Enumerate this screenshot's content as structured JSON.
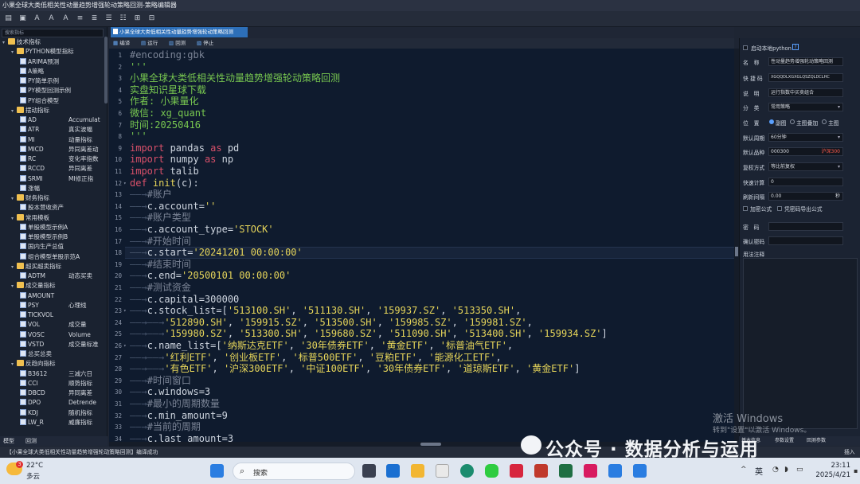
{
  "window": {
    "title": "小果全球大类低相关性动量趋势增强轮动策略回测-策略编辑器"
  },
  "toolbar": {
    "icons": [
      "save-icon",
      "save-as-icon",
      "font-increase-icon",
      "font-decrease-icon",
      "font-bold-icon",
      "indent-icon",
      "outdent-icon",
      "comment-icon",
      "list-icon",
      "format-icon",
      "export-icon"
    ]
  },
  "sidebar": {
    "search_placeholder": "搜索指标",
    "tree": [
      {
        "level": 0,
        "type": "folder",
        "open": true,
        "label": "技术指标"
      },
      {
        "level": 1,
        "type": "folder",
        "open": true,
        "label": "PYTHON模型指标"
      },
      {
        "level": 2,
        "type": "item",
        "label": "ARIMA预测",
        "desc": ""
      },
      {
        "level": 2,
        "type": "item",
        "label": "A策略",
        "desc": ""
      },
      {
        "level": 2,
        "type": "item",
        "label": "PY简单示例",
        "desc": ""
      },
      {
        "level": 2,
        "type": "item",
        "label": "PY模型回测示例",
        "desc": ""
      },
      {
        "level": 2,
        "type": "item",
        "label": "PY组合模型",
        "desc": ""
      },
      {
        "level": 1,
        "type": "folder",
        "open": true,
        "label": "摆动指标"
      },
      {
        "level": 2,
        "type": "item",
        "label": "AD",
        "desc": "Accumulat"
      },
      {
        "level": 2,
        "type": "item",
        "label": "ATR",
        "desc": "真实波幅"
      },
      {
        "level": 2,
        "type": "item",
        "label": "MI",
        "desc": "动量指标"
      },
      {
        "level": 2,
        "type": "item",
        "label": "MICD",
        "desc": "异同离差动"
      },
      {
        "level": 2,
        "type": "item",
        "label": "RC",
        "desc": "变化率指数"
      },
      {
        "level": 2,
        "type": "item",
        "label": "RCCD",
        "desc": "异同离差"
      },
      {
        "level": 2,
        "type": "item",
        "label": "SRMI",
        "desc": "MI修正指"
      },
      {
        "level": 2,
        "type": "item",
        "label": "涨幅",
        "desc": ""
      },
      {
        "level": 1,
        "type": "folder",
        "open": true,
        "label": "财务指标"
      },
      {
        "level": 2,
        "type": "item",
        "label": "股本营收资产",
        "desc": ""
      },
      {
        "level": 1,
        "type": "folder",
        "open": true,
        "label": "常用模板"
      },
      {
        "level": 2,
        "type": "item",
        "label": "单股模型示例A",
        "desc": ""
      },
      {
        "level": 2,
        "type": "item",
        "label": "单股模型示例B",
        "desc": ""
      },
      {
        "level": 2,
        "type": "item",
        "label": "国内生产总值",
        "desc": ""
      },
      {
        "level": 2,
        "type": "item",
        "label": "组合模型单股示范A",
        "desc": ""
      },
      {
        "level": 1,
        "type": "folder",
        "open": true,
        "label": "超买超卖指标"
      },
      {
        "level": 2,
        "type": "item",
        "label": "ADTM",
        "desc": "动态买卖"
      },
      {
        "level": 1,
        "type": "folder",
        "open": true,
        "label": "成交量指标"
      },
      {
        "level": 2,
        "type": "item",
        "label": "AMOUNT",
        "desc": ""
      },
      {
        "level": 2,
        "type": "item",
        "label": "PSY",
        "desc": "心理线"
      },
      {
        "level": 2,
        "type": "item",
        "label": "TICKVOL",
        "desc": ""
      },
      {
        "level": 2,
        "type": "item",
        "label": "VOL",
        "desc": "成交量"
      },
      {
        "level": 2,
        "type": "item",
        "label": "VOSC",
        "desc": "Volume"
      },
      {
        "level": 2,
        "type": "item",
        "label": "VSTD",
        "desc": "成交量标准"
      },
      {
        "level": 2,
        "type": "item",
        "label": "总买总卖",
        "desc": ""
      },
      {
        "level": 1,
        "type": "folder",
        "open": true,
        "label": "反趋向指标"
      },
      {
        "level": 2,
        "type": "item",
        "label": "B3612",
        "desc": "三减六日"
      },
      {
        "level": 2,
        "type": "item",
        "label": "CCI",
        "desc": "顺势指标"
      },
      {
        "level": 2,
        "type": "item",
        "label": "DBCD",
        "desc": "异同离差"
      },
      {
        "level": 2,
        "type": "item",
        "label": "DPO",
        "desc": "Detrende"
      },
      {
        "level": 2,
        "type": "item",
        "label": "KDJ",
        "desc": "随机指标"
      },
      {
        "level": 2,
        "type": "item",
        "label": "LW_R",
        "desc": "威廉指标"
      }
    ],
    "bottom_tabs": [
      "模型",
      "回测"
    ]
  },
  "editor": {
    "tab_title": "小果全球大类低相关性动量趋势增强轮动策略回测",
    "tools": [
      "编译",
      "运行",
      "回测",
      "停止"
    ],
    "lines": [
      [
        [
          "cm",
          "#encoding:gbk"
        ]
      ],
      [
        [
          "gr",
          "'''"
        ]
      ],
      [
        [
          "gr",
          "小果全球大类低相关性动量趋势增强轮动策略回测"
        ]
      ],
      [
        [
          "gr",
          "实盘知识星球下载"
        ]
      ],
      [
        [
          "gr",
          "作者: 小果量化"
        ]
      ],
      [
        [
          "gr",
          "微信: xg_quant"
        ]
      ],
      [
        [
          "gr",
          "时间:20250416"
        ]
      ],
      [
        [
          "gr",
          "'''"
        ]
      ],
      [
        [
          "kw",
          "import"
        ],
        [
          "tx",
          " pandas "
        ],
        [
          "kw",
          "as"
        ],
        [
          "tx",
          " pd"
        ]
      ],
      [
        [
          "kw",
          "import"
        ],
        [
          "tx",
          " numpy "
        ],
        [
          "kw",
          "as"
        ],
        [
          "tx",
          " np"
        ]
      ],
      [
        [
          "kw",
          "import"
        ],
        [
          "tx",
          " talib"
        ]
      ],
      [
        [
          "df",
          "def"
        ],
        [
          "st",
          " init"
        ],
        [
          "tx",
          "(c):"
        ]
      ],
      [
        [
          "arr",
          "——→"
        ],
        [
          "cm",
          "#账户"
        ]
      ],
      [
        [
          "arr",
          "——→"
        ],
        [
          "tx",
          "c.account="
        ],
        [
          "st",
          "''"
        ]
      ],
      [
        [
          "arr",
          "——→"
        ],
        [
          "cm",
          "#账户类型"
        ]
      ],
      [
        [
          "arr",
          "——→"
        ],
        [
          "tx",
          "c.account_type="
        ],
        [
          "st",
          "'STOCK'"
        ]
      ],
      [
        [
          "arr",
          "——→"
        ],
        [
          "cm",
          "#开始时间"
        ]
      ],
      [
        [
          "arr",
          "——→"
        ],
        [
          "tx",
          "c.start="
        ],
        [
          "st",
          "'20241201 00:00:00'"
        ]
      ],
      [
        [
          "arr",
          "——→"
        ],
        [
          "cm",
          "#结束时间"
        ]
      ],
      [
        [
          "arr",
          "——→"
        ],
        [
          "tx",
          "c.end="
        ],
        [
          "st",
          "'20500101 00:00:00'"
        ]
      ],
      [
        [
          "arr",
          "——→"
        ],
        [
          "cm",
          "#测试资金"
        ]
      ],
      [
        [
          "arr",
          "——→"
        ],
        [
          "tx",
          "c.capital=300000"
        ]
      ],
      [
        [
          "arr",
          "——→"
        ],
        [
          "tx",
          "c.stock_list=["
        ],
        [
          "st",
          "'513100.SH'"
        ],
        [
          "tx",
          ", "
        ],
        [
          "st",
          "'511130.SH'"
        ],
        [
          "tx",
          ", "
        ],
        [
          "st",
          "'159937.SZ'"
        ],
        [
          "tx",
          ", "
        ],
        [
          "st",
          "'513350.SH'"
        ],
        [
          "tx",
          ","
        ]
      ],
      [
        [
          "arr",
          "——→——→"
        ],
        [
          "st",
          "'512890.SH'"
        ],
        [
          "tx",
          ", "
        ],
        [
          "st",
          "'159915.SZ'"
        ],
        [
          "tx",
          ", "
        ],
        [
          "st",
          "'513500.SH'"
        ],
        [
          "tx",
          ", "
        ],
        [
          "st",
          "'159985.SZ'"
        ],
        [
          "tx",
          ", "
        ],
        [
          "st",
          "'159981.SZ'"
        ],
        [
          "tx",
          ","
        ]
      ],
      [
        [
          "arr",
          "——→——→"
        ],
        [
          "st",
          "'159980.SZ'"
        ],
        [
          "tx",
          ", "
        ],
        [
          "st",
          "'513300.SH'"
        ],
        [
          "tx",
          ", "
        ],
        [
          "st",
          "'159680.SZ'"
        ],
        [
          "tx",
          ", "
        ],
        [
          "st",
          "'511090.SH'"
        ],
        [
          "tx",
          ", "
        ],
        [
          "st",
          "'513400.SH'"
        ],
        [
          "tx",
          ", "
        ],
        [
          "st",
          "'159934.SZ'"
        ],
        [
          "tx",
          "]"
        ]
      ],
      [
        [
          "arr",
          "——→"
        ],
        [
          "tx",
          "c.name_list=["
        ],
        [
          "st",
          "'纳斯达克ETF'"
        ],
        [
          "tx",
          ", "
        ],
        [
          "st",
          "'30年债券ETF'"
        ],
        [
          "tx",
          ", "
        ],
        [
          "st",
          "'黄金ETF'"
        ],
        [
          "tx",
          ", "
        ],
        [
          "st",
          "'标普油气ETF'"
        ],
        [
          "tx",
          ","
        ]
      ],
      [
        [
          "arr",
          "——→——→"
        ],
        [
          "st",
          "'红利ETF'"
        ],
        [
          "tx",
          ", "
        ],
        [
          "st",
          "'创业板ETF'"
        ],
        [
          "tx",
          ", "
        ],
        [
          "st",
          "'标普500ETF'"
        ],
        [
          "tx",
          ", "
        ],
        [
          "st",
          "'豆粕ETF'"
        ],
        [
          "tx",
          ", "
        ],
        [
          "st",
          "'能源化工ETF'"
        ],
        [
          "tx",
          ","
        ]
      ],
      [
        [
          "arr",
          "——→——→"
        ],
        [
          "st",
          "'有色ETF'"
        ],
        [
          "tx",
          ", "
        ],
        [
          "st",
          "'沪深300ETF'"
        ],
        [
          "tx",
          ", "
        ],
        [
          "st",
          "'中证100ETF'"
        ],
        [
          "tx",
          ", "
        ],
        [
          "st",
          "'30年债券ETF'"
        ],
        [
          "tx",
          ", "
        ],
        [
          "st",
          "'道琼斯ETF'"
        ],
        [
          "tx",
          ", "
        ],
        [
          "st",
          "'黄金ETF'"
        ],
        [
          "tx",
          "]"
        ]
      ],
      [
        [
          "arr",
          "——→"
        ],
        [
          "cm",
          "#时间窗口"
        ]
      ],
      [
        [
          "arr",
          "——→"
        ],
        [
          "tx",
          "c.windows=3"
        ]
      ],
      [
        [
          "arr",
          "——→"
        ],
        [
          "cm",
          "#最小的周期数量"
        ]
      ],
      [
        [
          "arr",
          "——→"
        ],
        [
          "tx",
          "c.min_amount=9"
        ]
      ],
      [
        [
          "arr",
          "——→"
        ],
        [
          "cm",
          "#当前的周期"
        ]
      ],
      [
        [
          "arr",
          "——→"
        ],
        [
          "tx",
          "c.last_amount=3"
        ]
      ]
    ],
    "fold_markers": [
      "12",
      "23",
      "26"
    ],
    "current_line": "18"
  },
  "properties": {
    "enable_python_label": "启动本地python",
    "name_label": "名　称",
    "name_value": "性动量趋势增强轮动策略回测",
    "shortcut_label": "快 捷 码",
    "shortcut_value": "XGQQDLXGXGLQSZQLDCLHC",
    "desc_label": "说　明",
    "desc_value": "运行指数中买卖组合",
    "category_label": "分　类",
    "category_value": "常用策略",
    "position_label": "位　置",
    "position_options": [
      "副图",
      "主图叠加",
      "主图"
    ],
    "default_period_label": "默认周期",
    "default_period_value": "60分钟",
    "default_product_label": "默认品种",
    "default_product_value": "000300",
    "default_product_tag": "沪深300",
    "adjust_label": "复权方式",
    "adjust_value": "等比前复权",
    "quick_calc_label": "快速计算",
    "quick_calc_value": "0",
    "refresh_label": "刷新间隔",
    "refresh_value": "0.00",
    "refresh_unit": "秒",
    "encrypt_label": "加密公式",
    "export_pwd_label": "凭密码导出公式",
    "password_label": "密　码",
    "confirm_pwd_label": "确认密码",
    "usage_label": "用法注释",
    "bottom_tabs": [
      "基本信息",
      "参数设置",
      "回测参数"
    ]
  },
  "statusbar": {
    "file": "【小果全球大类低相关性动量趋势增强轮动策略回测】编译成功",
    "mode": "插入"
  },
  "overlay": {
    "activate_title": "激活 Windows",
    "activate_sub": "转到\"设置\"以激活 Windows。",
    "wechat_brand": "公众号 · 数据分析与运用"
  },
  "taskbar": {
    "weather_temp": "22°C",
    "weather_desc": "多云",
    "weather_badge": "3",
    "search_placeholder": "搜索",
    "ime": "英",
    "time": "23:11",
    "date": "2025/4/21",
    "colors": {
      "start": "#2a7de1",
      "edge": "#1b8c6e",
      "wechat": "#2ecc40",
      "wps": "#d7263d",
      "vscode": "#2a7de1"
    }
  }
}
